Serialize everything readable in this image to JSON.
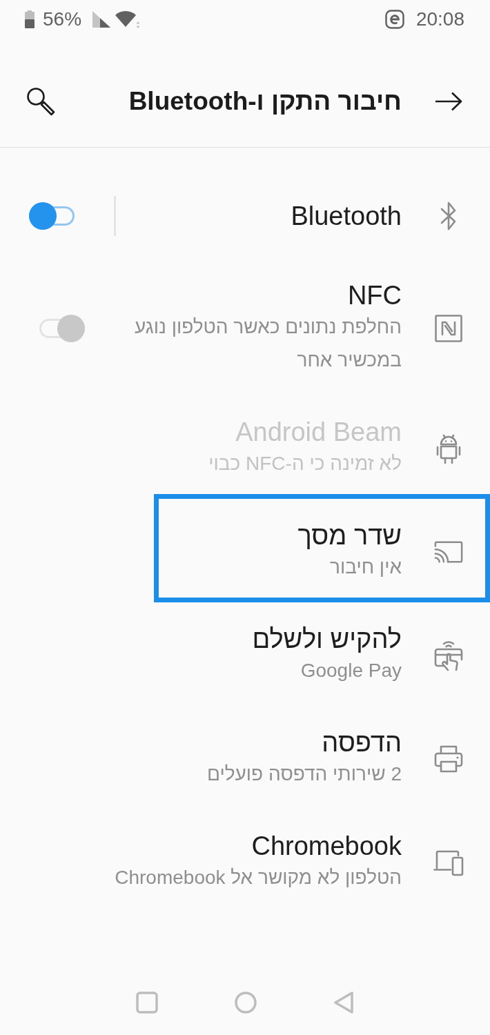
{
  "status_bar": {
    "battery": "56%",
    "time": "20:08"
  },
  "header": {
    "title": "חיבור התקן ו-Bluetooth"
  },
  "items": [
    {
      "kind": "split_switch",
      "title": "Bluetooth",
      "on": true,
      "disabled": false,
      "highlighted": false
    },
    {
      "kind": "switch",
      "title": "NFC",
      "subtitle": "החלפת נתונים כאשר הטלפון נוגע במכשיר אחר",
      "on": false,
      "disabled": false,
      "highlighted": false
    },
    {
      "kind": "link",
      "title": "Android Beam",
      "subtitle": "לא זמינה כי ה-NFC כבוי",
      "disabled": true,
      "highlighted": false
    },
    {
      "kind": "link",
      "title": "שדר מסך",
      "subtitle": "אין חיבור",
      "disabled": false,
      "highlighted": true
    },
    {
      "kind": "link",
      "title": "להקיש ולשלם",
      "subtitle": "Google Pay",
      "disabled": false,
      "highlighted": false
    },
    {
      "kind": "link",
      "title": "הדפסה",
      "subtitle": "2 שירותי הדפסה פועלים",
      "disabled": false,
      "highlighted": false
    },
    {
      "kind": "link",
      "title": "Chromebook",
      "subtitle": "הטלפון לא מקושר אל Chromebook",
      "disabled": false,
      "highlighted": false
    }
  ]
}
